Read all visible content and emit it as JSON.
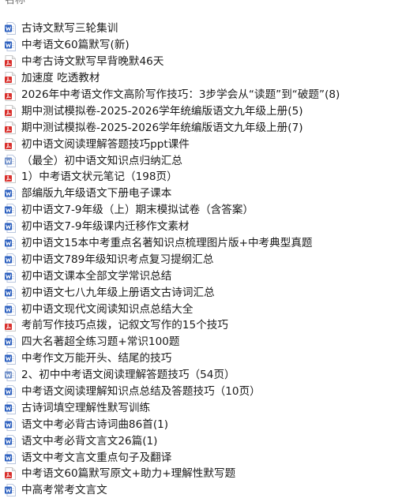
{
  "header": {
    "column_name": "名称"
  },
  "colors": {
    "word": "#2b5fbf",
    "pdf": "#d9302c",
    "text": "#1a1a1a"
  },
  "files": [
    {
      "type": "word",
      "icon": "word-doc-icon",
      "name": "古诗文默写三轮集训"
    },
    {
      "type": "word",
      "icon": "word-doc-icon",
      "name": "中考语文60篇默写(新)"
    },
    {
      "type": "pdf",
      "icon": "pdf-doc-icon",
      "name": "中考古诗文默写早背晚默46天"
    },
    {
      "type": "pdf",
      "icon": "pdf-doc-icon",
      "name": "加速度 吃透教材"
    },
    {
      "type": "pdf",
      "icon": "pdf-doc-icon",
      "name": "2026年中考语文作文高阶写作技巧：3步学会从“读题”到“破题”(8)"
    },
    {
      "type": "pdf",
      "icon": "pdf-doc-icon",
      "name": "期中测试模拟卷-2025-2026学年统编版语文九年级上册(5)"
    },
    {
      "type": "pdf",
      "icon": "pdf-doc-icon",
      "name": "期中测试模拟卷-2025-2026学年统编版语文九年级上册(7)"
    },
    {
      "type": "pdf",
      "icon": "pdf-doc-icon",
      "name": "初中语文阅读理解答题技巧ppt课件"
    },
    {
      "type": "word-old",
      "icon": "word-doc-icon",
      "name": "（最全）初中语文知识点归纳汇总"
    },
    {
      "type": "pdf",
      "icon": "pdf-doc-icon",
      "name": "1）中考语文状元笔记（198页）"
    },
    {
      "type": "word",
      "icon": "word-doc-icon",
      "name": "部编版九年级语文下册电子课本"
    },
    {
      "type": "word",
      "icon": "word-doc-icon",
      "name": "初中语文7-9年级（上）期末模拟试卷（含答案）"
    },
    {
      "type": "word",
      "icon": "word-doc-icon",
      "name": "初中语文7-9年级课内迁移作文素材"
    },
    {
      "type": "word",
      "icon": "word-doc-icon",
      "name": "初中语文15本中考重点名著知识点梳理图片版+中考典型真题"
    },
    {
      "type": "word",
      "icon": "word-doc-icon",
      "name": "初中语文789年级知识考点复习提纲汇总"
    },
    {
      "type": "word",
      "icon": "word-doc-icon",
      "name": "初中语文课本全部文学常识总结"
    },
    {
      "type": "word",
      "icon": "word-doc-icon",
      "name": "初中语文七八九年级上册语文古诗词汇总"
    },
    {
      "type": "word",
      "icon": "word-doc-icon",
      "name": "初中语文现代文阅读知识点总结大全"
    },
    {
      "type": "pdf",
      "icon": "pdf-doc-icon",
      "name": "考前写作技巧点拨，记叙文写作的15个技巧"
    },
    {
      "type": "word",
      "icon": "word-doc-icon",
      "name": "四大名著超全练习题+常识100题"
    },
    {
      "type": "word",
      "icon": "word-doc-icon",
      "name": "中考作文万能开头、结尾的技巧"
    },
    {
      "type": "word-old",
      "icon": "word-doc-icon",
      "name": "2、初中中考语文阅读理解答题技巧（54页）"
    },
    {
      "type": "word",
      "icon": "word-doc-icon",
      "name": "中考语文阅读理解知识点总结及答题技巧（10页）"
    },
    {
      "type": "word",
      "icon": "word-doc-icon",
      "name": "古诗词填空理解性默写训练"
    },
    {
      "type": "word",
      "icon": "word-doc-icon",
      "name": "语文中考必背古诗词曲86首(1)"
    },
    {
      "type": "word",
      "icon": "word-doc-icon",
      "name": "语文中考必背文言文26篇(1)"
    },
    {
      "type": "word",
      "icon": "word-doc-icon",
      "name": "语文中考文言文重点句子及翻译"
    },
    {
      "type": "pdf",
      "icon": "pdf-doc-icon",
      "name": "中考语文60篇默写原文+助力+理解性默写题"
    },
    {
      "type": "word",
      "icon": "word-doc-icon",
      "name": "中高考常考文言文"
    }
  ]
}
